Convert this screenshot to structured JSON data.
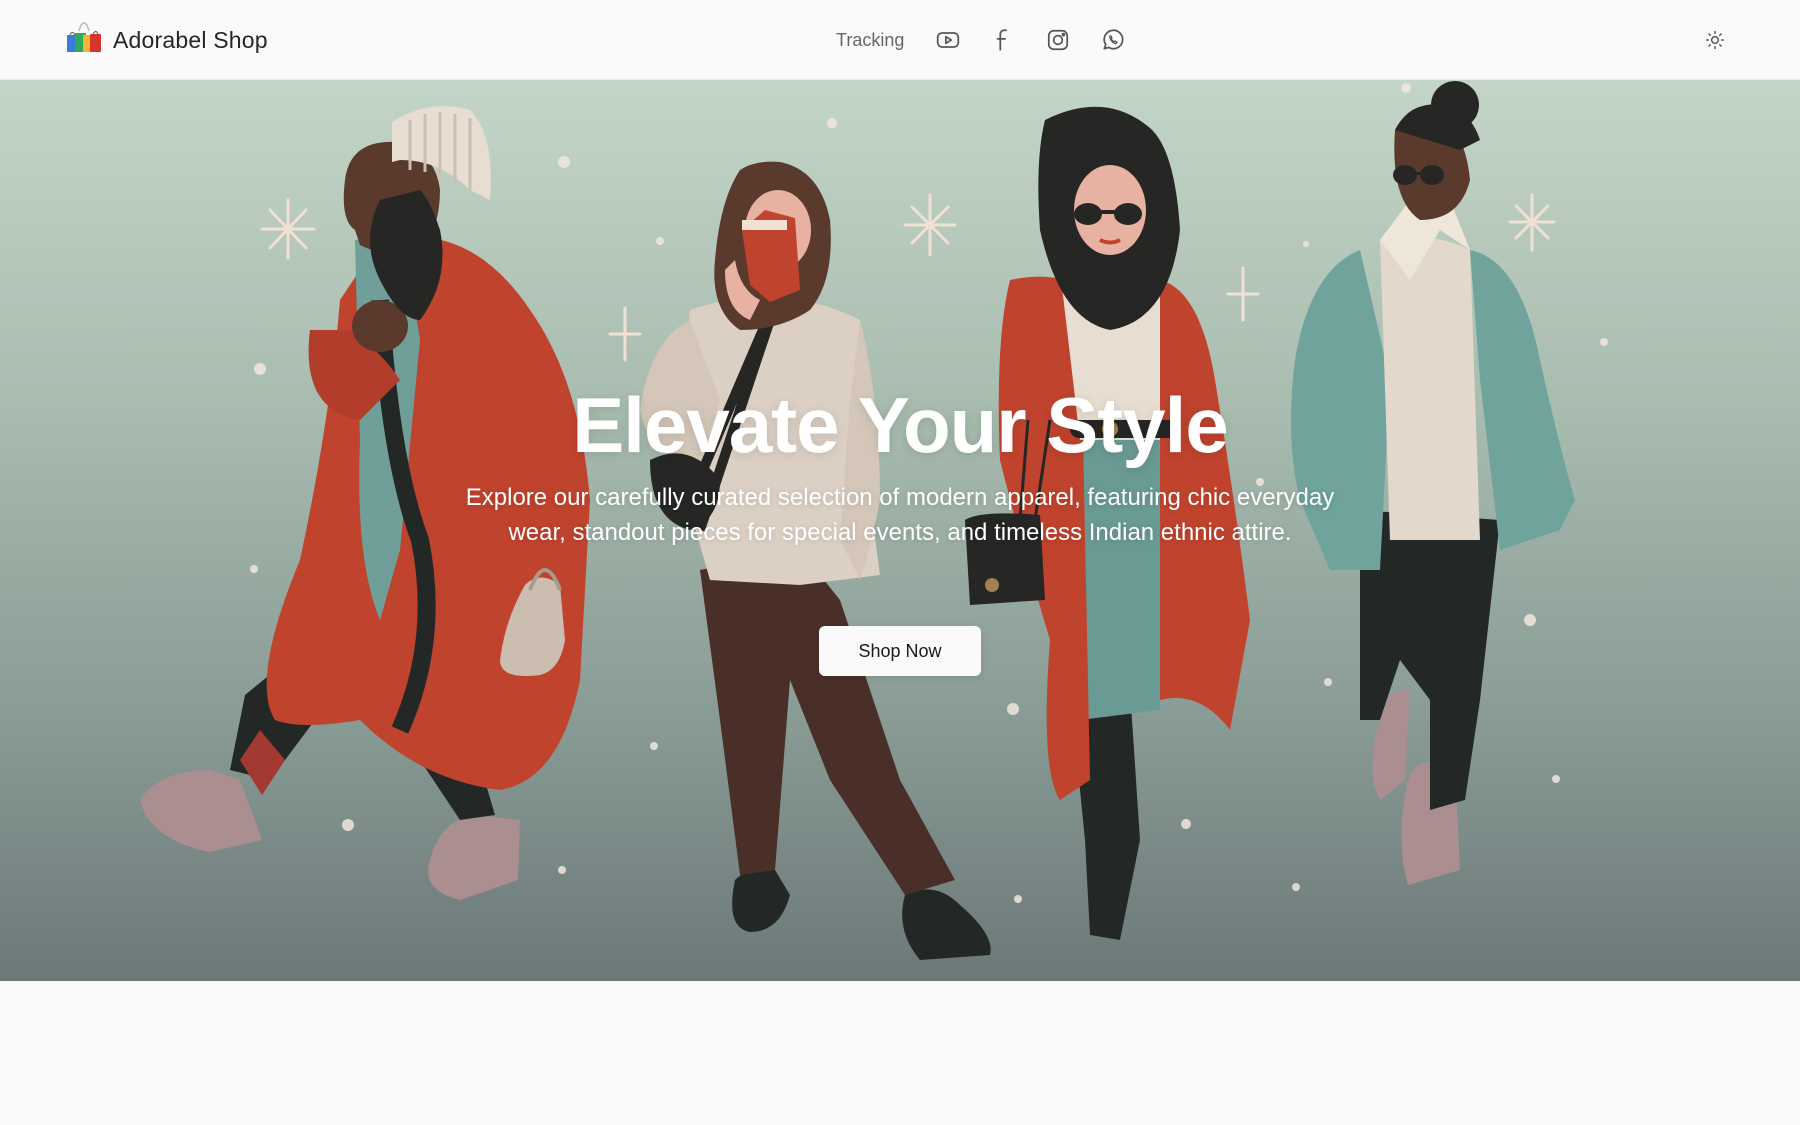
{
  "brand": {
    "name": "Adorabel Shop",
    "logo_icon": "shopping-bags-logo-icon"
  },
  "nav": {
    "tracking_label": "Tracking",
    "social_icons": [
      "youtube-icon",
      "facebook-icon",
      "instagram-icon",
      "whatsapp-icon"
    ]
  },
  "theme_toggle_icon": "sun-icon",
  "hero": {
    "title": "Elevate Your Style",
    "subtitle": "Explore our carefully curated selection of modern apparel, featuring chic everyday wear, standout pieces for special events, and timeless Indian ethnic attire.",
    "cta_label": "Shop Now",
    "illustration": "four-women-winter-fashion-illustration"
  },
  "colors": {
    "header_bg": "#fafafa",
    "hero_gradient_top": "#c3d5c7",
    "hero_gradient_bottom": "#6b7878",
    "coat_red": "#c0432e",
    "jacket_teal": "#6fa39c",
    "cta_bg": "#fafafa"
  }
}
